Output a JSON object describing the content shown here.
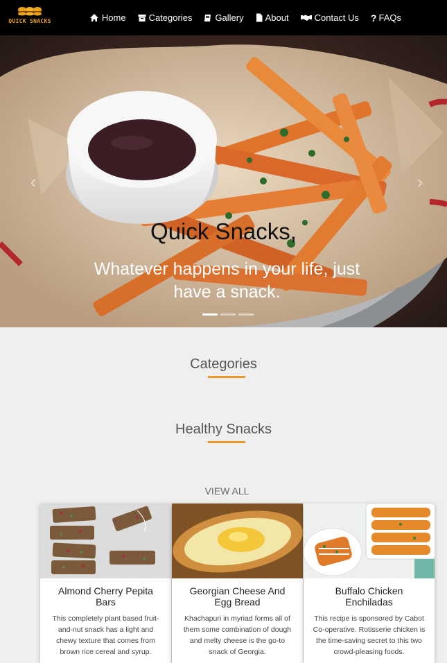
{
  "brand": {
    "name": "QUICK SNACKS",
    "logo_icon": "burgers-logo"
  },
  "nav": {
    "items": [
      {
        "label": "Home",
        "icon": "home-icon"
      },
      {
        "label": "Categories",
        "icon": "box-icon"
      },
      {
        "label": "Gallery",
        "icon": "book-icon"
      },
      {
        "label": "About",
        "icon": "file-icon"
      },
      {
        "label": "Contact Us",
        "icon": "handshake-icon"
      },
      {
        "label": "FAQs",
        "icon": "question-icon"
      }
    ]
  },
  "hero": {
    "title": "Quick Snacks,",
    "subtitle": "Whatever happens in your life, just have a snack.",
    "slides_count": 3,
    "active_slide": 1
  },
  "sections": {
    "categories": "Categories",
    "healthy": "Healthy Snacks",
    "view_all": "VIEW ALL"
  },
  "cards": [
    {
      "title": "Almond Cherry Pepita Bars",
      "desc": "This completely plant based fruit-and-nut snack has a light and chewy texture that comes from brown rice cereal and syrup."
    },
    {
      "title": "Georgian Cheese And Egg Bread",
      "desc": "Khachapuri in myriad forms all of them some combination of dough and melty cheese is the go-to snack of Georgia."
    },
    {
      "title": "Buffalo Chicken Enchiladas",
      "desc": "This recipe is sponsored by Cabot Co-operative. Rotisserie chicken is the time-saving secret to this two crowd-pleasing foods."
    }
  ],
  "colors": {
    "accent": "#e8972c",
    "nav_bg": "#000000",
    "page_bg": "#efefef"
  }
}
